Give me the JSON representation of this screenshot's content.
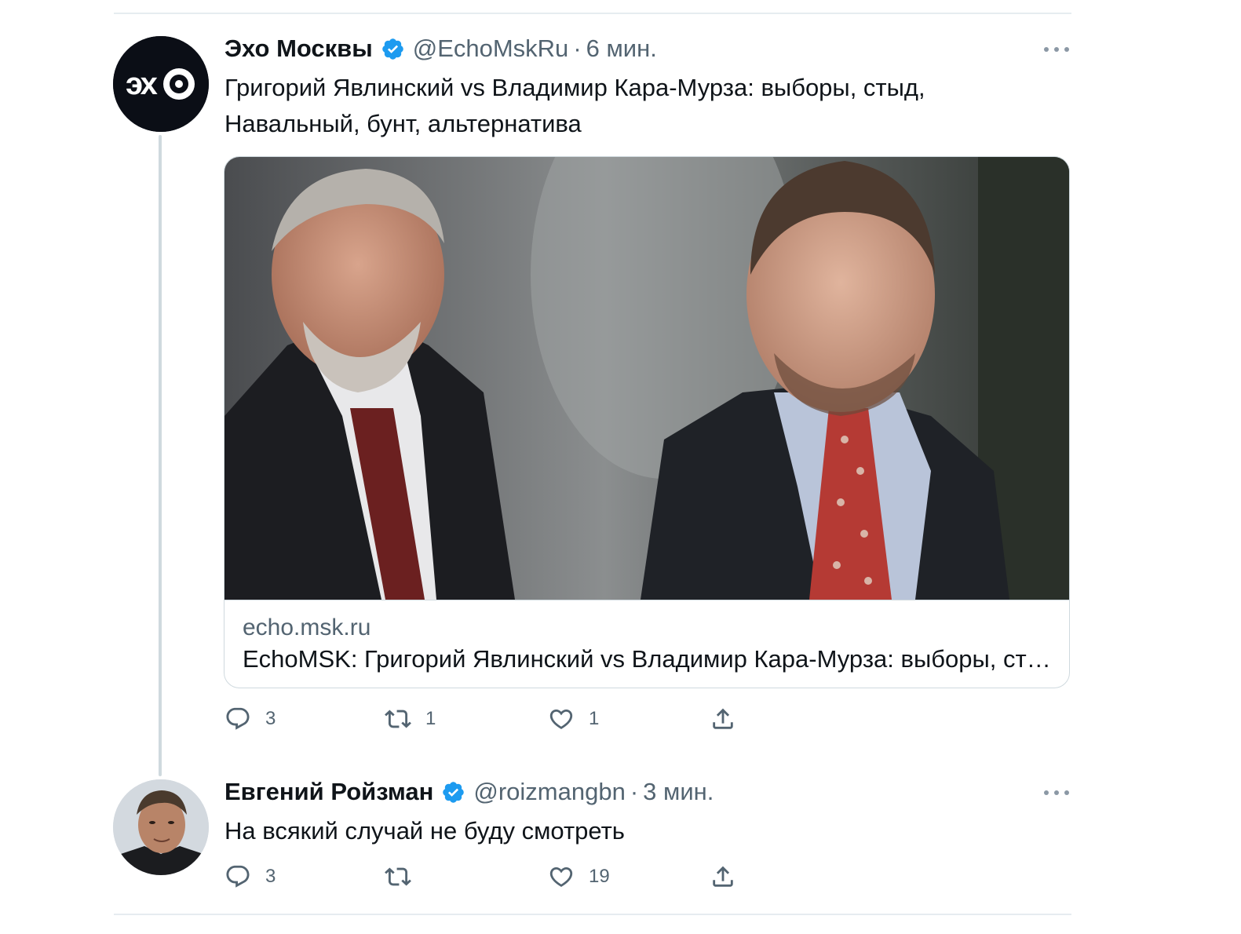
{
  "tweets": [
    {
      "author": "Эхо Москвы",
      "handle": "@EchoMskRu",
      "separator": "·",
      "time": "6 мин.",
      "text": "Григорий Явлинский vs Владимир Кара-Мурза: выборы, стыд, Навальный, бунт, альтернатива",
      "avatar_text": "эхо",
      "card": {
        "domain": "echo.msk.ru",
        "title": "EchoMSK: Григорий Явлинский vs Владимир Кара-Мурза: выборы, стыд, Навальный, бунт, альтернатива"
      },
      "stats": {
        "replies": "3",
        "retweets": "1",
        "likes": "1"
      }
    },
    {
      "author": "Евгений Ройзман",
      "handle": "@roizmangbn",
      "separator": "·",
      "time": "3 мин.",
      "text": "На всякий случай не буду смотреть",
      "stats": {
        "replies": "3",
        "retweets": "",
        "likes": "19"
      }
    }
  ],
  "icons": {
    "verified": "verified-badge-icon",
    "more": "more-dots-icon",
    "reply": "reply-icon",
    "retweet": "retweet-icon",
    "like": "heart-icon",
    "share": "share-icon"
  },
  "colors": {
    "verified": "#1d9bf0",
    "secondary_text": "#536471",
    "border": "#cfd9de",
    "echo_avatar_bg": "#0b0e16"
  }
}
